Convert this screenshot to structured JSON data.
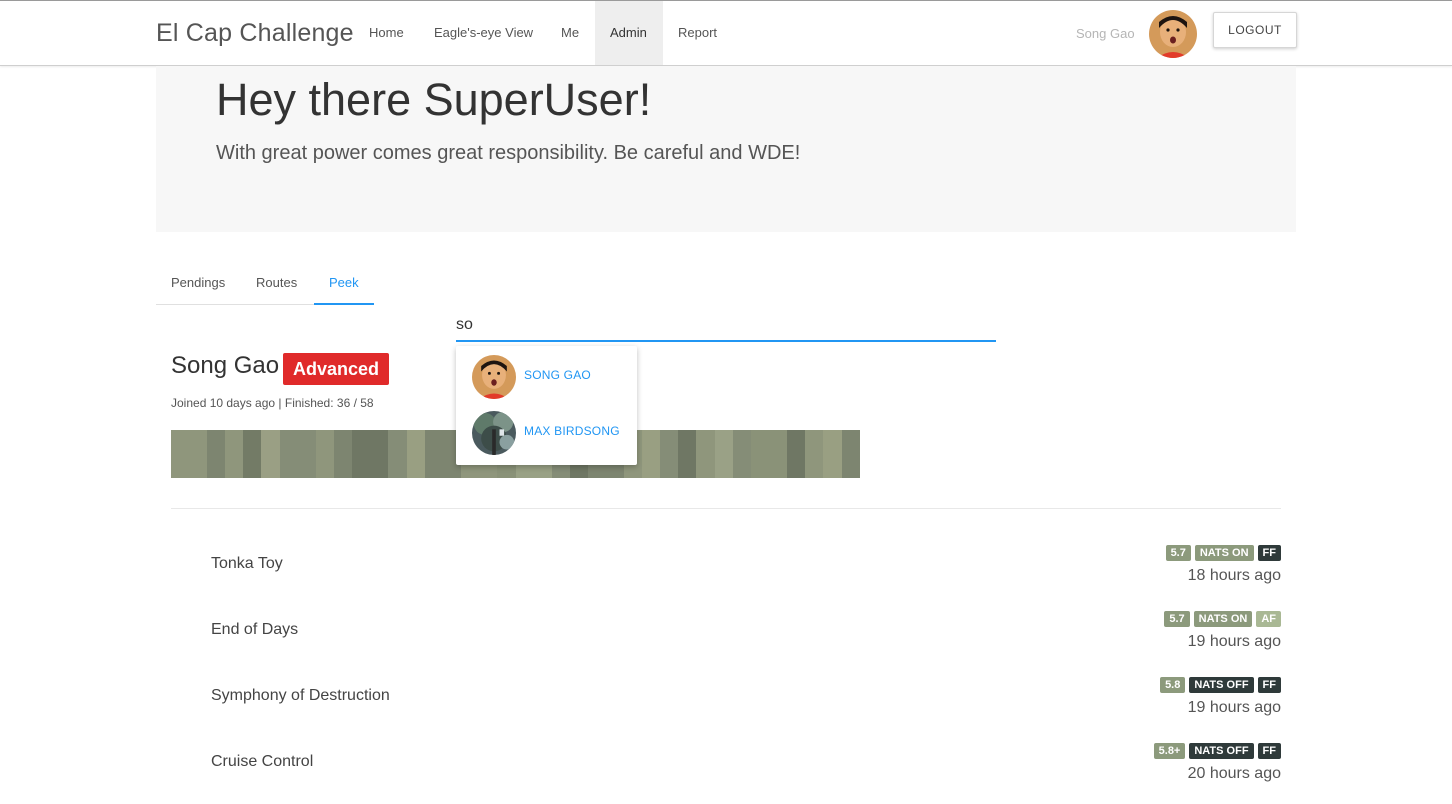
{
  "navbar": {
    "brand": "El Cap Challenge",
    "items": [
      {
        "label": "Home",
        "active": false
      },
      {
        "label": "Eagle's-eye View",
        "active": false
      },
      {
        "label": "Me",
        "active": false
      },
      {
        "label": "Admin",
        "active": true
      },
      {
        "label": "Report",
        "active": false
      }
    ],
    "user_name": "Song Gao",
    "logout_label": "LOGOUT"
  },
  "jumbotron": {
    "title": "Hey there SuperUser!",
    "subtitle": "With great power comes great responsibility. Be careful and WDE!"
  },
  "tabs": [
    {
      "label": "Pendings",
      "active": false
    },
    {
      "label": "Routes",
      "active": false
    },
    {
      "label": "Peek",
      "active": true
    }
  ],
  "search": {
    "value": "so",
    "placeholder": ""
  },
  "suggestions": [
    {
      "label": "SONG GAO",
      "avatar": "orange-face"
    },
    {
      "label": "MAX BIRDSONG",
      "avatar": "tree-photo"
    }
  ],
  "profile": {
    "name": "Song Gao",
    "level": "Advanced",
    "meta": "Joined 10 days ago | Finished: 36 / 58"
  },
  "colors": {
    "accent": "#2196f3",
    "level_red": "#e02a2a",
    "grade_green": "#8c9a7c",
    "nats_on": "#8c9a7c",
    "nats_off": "#2f3a3a",
    "ff": "#2f3a3a",
    "af": "#a9b894"
  },
  "routes": [
    {
      "name": "Tonka Toy",
      "grade": "5.7",
      "nats": "NATS ON",
      "style": "FF",
      "time": "18 hours ago"
    },
    {
      "name": "End of Days",
      "grade": "5.7",
      "nats": "NATS ON",
      "style": "AF",
      "time": "19 hours ago"
    },
    {
      "name": "Symphony of Destruction",
      "grade": "5.8",
      "nats": "NATS OFF",
      "style": "FF",
      "time": "19 hours ago"
    },
    {
      "name": "Cruise Control",
      "grade": "5.8+",
      "nats": "NATS OFF",
      "style": "FF",
      "time": "20 hours ago"
    }
  ]
}
